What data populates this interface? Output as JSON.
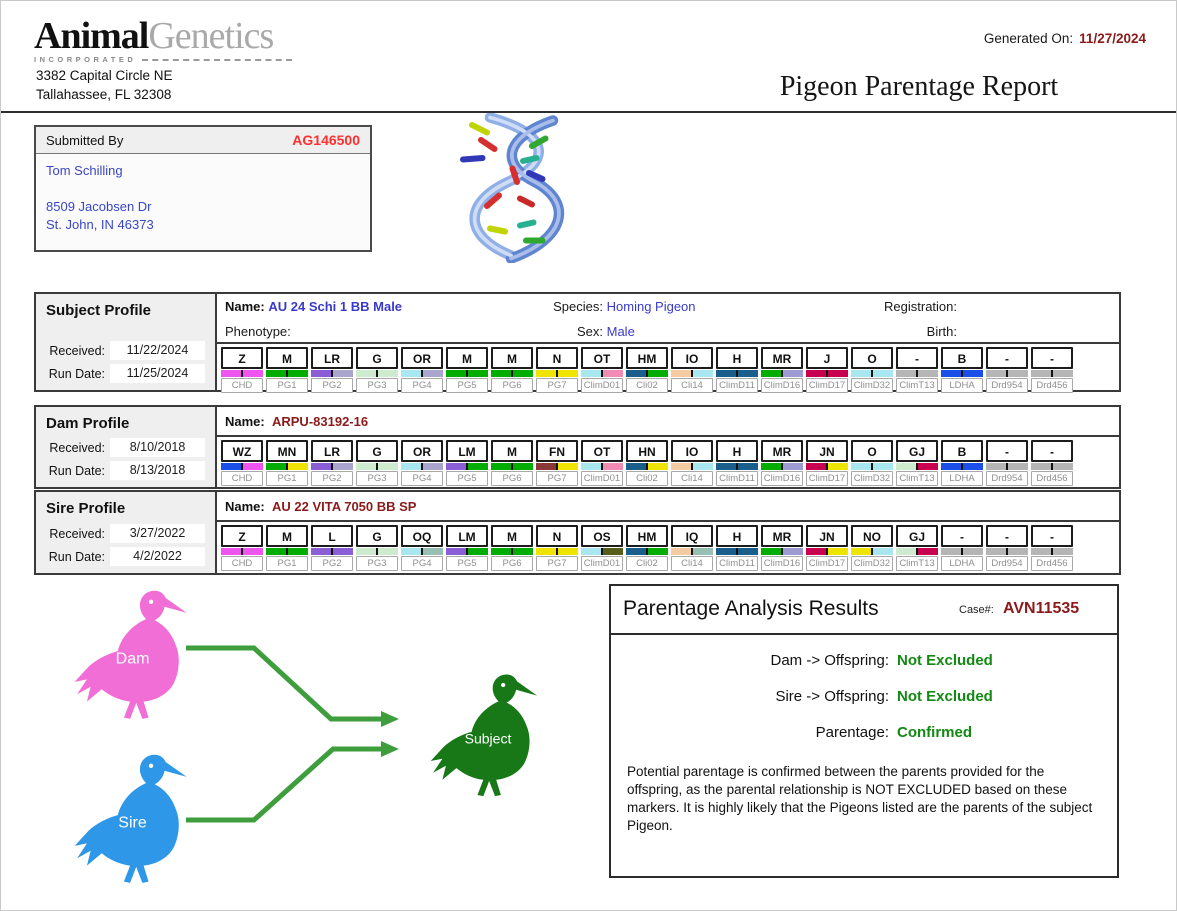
{
  "header": {
    "logo_animal": "Animal",
    "logo_genetics": "Genetics",
    "logo_incorporated": "INCORPORATED",
    "address_line1": "3382 Capital Circle NE",
    "address_line2": "Tallahassee, FL 32308",
    "generated_on_label": "Generated On:",
    "generated_on_date": "11/27/2024",
    "report_title": "Pigeon Parentage Report"
  },
  "submitted_by": {
    "label": "Submitted By",
    "account_id": "AG146500",
    "name": "Tom Schilling",
    "address_line1": "8509 Jacobsen Dr",
    "address_line2": "St. John,  IN 46373"
  },
  "marker_labels": [
    "CHD",
    "PG1",
    "PG2",
    "PG3",
    "PG4",
    "PG5",
    "PG6",
    "PG7",
    "ClimD01",
    "Cli02",
    "Cli14",
    "ClimD11",
    "ClimD16",
    "ClimD17",
    "ClimD32",
    "ClimT13",
    "LDHA",
    "Drd954",
    "Drd456"
  ],
  "profiles": [
    {
      "title": "Subject Profile",
      "received_label": "Received:",
      "received": "11/22/2024",
      "run_date_label": "Run Date:",
      "run_date": "11/25/2024",
      "name_label": "Name:",
      "name": "AU 24 Schi 1 BB Male",
      "species_label": "Species:",
      "species": "Homing Pigeon",
      "registration_label": "Registration:",
      "registration": "",
      "phenotype_label": "Phenotype:",
      "phenotype": "",
      "sex_label": "Sex:",
      "sex": "Male",
      "birth_label": "Birth:",
      "birth": "",
      "markers": [
        {
          "allele": "Z",
          "colors": [
            "#ee55ee",
            "#ee55ee"
          ]
        },
        {
          "allele": "M",
          "colors": [
            "#00ad00",
            "#00ad00"
          ]
        },
        {
          "allele": "LR",
          "colors": [
            "#8a5fd6",
            "#a9a5ce"
          ]
        },
        {
          "allele": "G",
          "colors": [
            "#cfebcf",
            "#cfebcf"
          ]
        },
        {
          "allele": "OR",
          "colors": [
            "#a8e6f0",
            "#a9a5ce"
          ]
        },
        {
          "allele": "M",
          "colors": [
            "#00ad00",
            "#00ad00"
          ]
        },
        {
          "allele": "M",
          "colors": [
            "#00ad00",
            "#00ad00"
          ]
        },
        {
          "allele": "N",
          "colors": [
            "#efe400",
            "#efe400"
          ]
        },
        {
          "allele": "OT",
          "colors": [
            "#a8e6f0",
            "#f08cb4"
          ]
        },
        {
          "allele": "HM",
          "colors": [
            "#1a5e8c",
            "#00ad00"
          ]
        },
        {
          "allele": "IO",
          "colors": [
            "#f5cba4",
            "#a8e6f0"
          ]
        },
        {
          "allele": "H",
          "colors": [
            "#1a5e8c",
            "#1a5e8c"
          ]
        },
        {
          "allele": "MR",
          "colors": [
            "#00ad00",
            "#9e9ad2"
          ]
        },
        {
          "allele": "J",
          "colors": [
            "#c80050",
            "#c80050"
          ]
        },
        {
          "allele": "O",
          "colors": [
            "#a8e6f0",
            "#a8e6f0"
          ]
        },
        {
          "allele": "-",
          "colors": [
            "#b5b5b5",
            "#b5b5b5"
          ]
        },
        {
          "allele": "B",
          "colors": [
            "#1c4fe8",
            "#1c4fe8"
          ]
        },
        {
          "allele": "-",
          "colors": [
            "#b5b5b5",
            "#b5b5b5"
          ]
        },
        {
          "allele": "-",
          "colors": [
            "#b5b5b5",
            "#b5b5b5"
          ]
        }
      ]
    },
    {
      "title": "Dam Profile",
      "received_label": "Received:",
      "received": "8/10/2018",
      "run_date_label": "Run Date:",
      "run_date": "8/13/2018",
      "name_label": "Name:",
      "name": "ARPU-83192-16",
      "markers": [
        {
          "allele": "WZ",
          "colors": [
            "#1c4fe8",
            "#ee55ee"
          ]
        },
        {
          "allele": "MN",
          "colors": [
            "#00ad00",
            "#efe400"
          ]
        },
        {
          "allele": "LR",
          "colors": [
            "#8a5fd6",
            "#a9a5ce"
          ]
        },
        {
          "allele": "G",
          "colors": [
            "#cfebcf",
            "#cfebcf"
          ]
        },
        {
          "allele": "OR",
          "colors": [
            "#a8e6f0",
            "#a9a5ce"
          ]
        },
        {
          "allele": "LM",
          "colors": [
            "#8a5fd6",
            "#00ad00"
          ]
        },
        {
          "allele": "M",
          "colors": [
            "#00ad00",
            "#00ad00"
          ]
        },
        {
          "allele": "FN",
          "colors": [
            "#8b3838",
            "#efe400"
          ]
        },
        {
          "allele": "OT",
          "colors": [
            "#a8e6f0",
            "#f08cb4"
          ]
        },
        {
          "allele": "HN",
          "colors": [
            "#1a5e8c",
            "#efe400"
          ]
        },
        {
          "allele": "IO",
          "colors": [
            "#f5cba4",
            "#a8e6f0"
          ]
        },
        {
          "allele": "H",
          "colors": [
            "#1a5e8c",
            "#1a5e8c"
          ]
        },
        {
          "allele": "MR",
          "colors": [
            "#00ad00",
            "#9e9ad2"
          ]
        },
        {
          "allele": "JN",
          "colors": [
            "#c80050",
            "#efe400"
          ]
        },
        {
          "allele": "O",
          "colors": [
            "#a8e6f0",
            "#a8e6f0"
          ]
        },
        {
          "allele": "GJ",
          "colors": [
            "#cfebcf",
            "#c80050"
          ]
        },
        {
          "allele": "B",
          "colors": [
            "#1c4fe8",
            "#1c4fe8"
          ]
        },
        {
          "allele": "-",
          "colors": [
            "#b5b5b5",
            "#b5b5b5"
          ]
        },
        {
          "allele": "-",
          "colors": [
            "#b5b5b5",
            "#b5b5b5"
          ]
        }
      ]
    },
    {
      "title": "Sire Profile",
      "received_label": "Received:",
      "received": "3/27/2022",
      "run_date_label": "Run Date:",
      "run_date": "4/2/2022",
      "name_label": "Name:",
      "name": "AU 22 VITA 7050 BB SP",
      "markers": [
        {
          "allele": "Z",
          "colors": [
            "#ee55ee",
            "#ee55ee"
          ]
        },
        {
          "allele": "M",
          "colors": [
            "#00ad00",
            "#00ad00"
          ]
        },
        {
          "allele": "L",
          "colors": [
            "#8a5fd6",
            "#8a5fd6"
          ]
        },
        {
          "allele": "G",
          "colors": [
            "#cfebcf",
            "#cfebcf"
          ]
        },
        {
          "allele": "OQ",
          "colors": [
            "#a8e6f0",
            "#97bfb4"
          ]
        },
        {
          "allele": "LM",
          "colors": [
            "#8a5fd6",
            "#00ad00"
          ]
        },
        {
          "allele": "M",
          "colors": [
            "#00ad00",
            "#00ad00"
          ]
        },
        {
          "allele": "N",
          "colors": [
            "#efe400",
            "#efe400"
          ]
        },
        {
          "allele": "OS",
          "colors": [
            "#a8e6f0",
            "#555f1a"
          ]
        },
        {
          "allele": "HM",
          "colors": [
            "#1a5e8c",
            "#00ad00"
          ]
        },
        {
          "allele": "IQ",
          "colors": [
            "#f5cba4",
            "#97bfb4"
          ]
        },
        {
          "allele": "H",
          "colors": [
            "#1a5e8c",
            "#1a5e8c"
          ]
        },
        {
          "allele": "MR",
          "colors": [
            "#00ad00",
            "#9e9ad2"
          ]
        },
        {
          "allele": "JN",
          "colors": [
            "#c80050",
            "#efe400"
          ]
        },
        {
          "allele": "NO",
          "colors": [
            "#efe400",
            "#a8e6f0"
          ]
        },
        {
          "allele": "GJ",
          "colors": [
            "#cfebcf",
            "#c80050"
          ]
        },
        {
          "allele": "-",
          "colors": [
            "#b5b5b5",
            "#b5b5b5"
          ]
        },
        {
          "allele": "-",
          "colors": [
            "#b5b5b5",
            "#b5b5b5"
          ]
        },
        {
          "allele": "-",
          "colors": [
            "#b5b5b5",
            "#b5b5b5"
          ]
        }
      ]
    }
  ],
  "analysis": {
    "title": "Parentage Analysis Results",
    "case_label": "Case#:",
    "case_number": "AVN11535",
    "rows": [
      {
        "label": "Dam -> Offspring:",
        "value": "Not Excluded"
      },
      {
        "label": "Sire -> Offspring:",
        "value": "Not Excluded"
      },
      {
        "label": "Parentage:",
        "value": "Confirmed"
      }
    ],
    "note": "Potential parentage is confirmed between the parents provided for the offspring, as the parental relationship is NOT EXCLUDED based on these markers.  It is highly likely that the Pigeons listed are the parents of the subject Pigeon."
  },
  "diagram": {
    "dam_label": "Dam",
    "sire_label": "Sire",
    "subject_label": "Subject",
    "dam_color": "#f06ed6",
    "sire_color": "#2e97e8",
    "subject_color": "#187818",
    "arrow_color": "#3e9e3e"
  },
  "colors": {
    "accent_red": "#fa3232",
    "maroon": "#8b1a1a",
    "link_blue": "#3a3ac8",
    "result_green": "#128912"
  }
}
